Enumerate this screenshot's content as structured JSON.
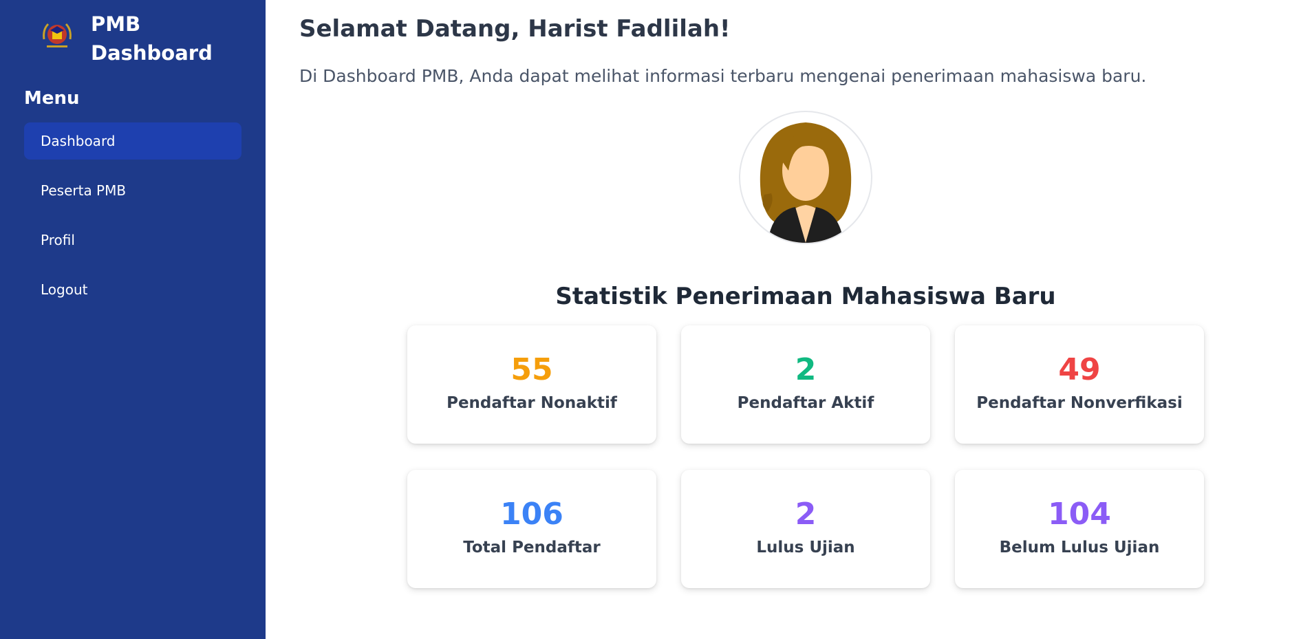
{
  "sidebar": {
    "brand_title_line1": "PMB",
    "brand_title_line2": "Dashboard",
    "brand_logo_icon": "graduation-emblem-icon",
    "menu_heading": "Menu",
    "items": [
      {
        "label": "Dashboard",
        "active": true
      },
      {
        "label": "Peserta PMB",
        "active": false
      },
      {
        "label": "Profil",
        "active": false
      },
      {
        "label": "Logout",
        "active": false
      }
    ]
  },
  "main": {
    "welcome": "Selamat Datang, Harist Fadlilah!",
    "intro": "Di Dashboard PMB, Anda dapat melihat informasi terbaru mengenai penerimaan mahasiswa baru.",
    "avatar_icon": "user-avatar-icon",
    "stats_title": "Statistik Penerimaan Mahasiswa Baru",
    "stats": [
      {
        "value": "55",
        "label": "Pendaftar Nonaktif",
        "color": "#f59e0b"
      },
      {
        "value": "2",
        "label": "Pendaftar Aktif",
        "color": "#10b981"
      },
      {
        "value": "49",
        "label": "Pendaftar Nonverfikasi",
        "color": "#ef4444"
      },
      {
        "value": "106",
        "label": "Total Pendaftar",
        "color": "#3b82f6"
      },
      {
        "value": "2",
        "label": "Lulus Ujian",
        "color": "#8b5cf6"
      },
      {
        "value": "104",
        "label": "Belum Lulus Ujian",
        "color": "#8b5cf6"
      }
    ]
  },
  "colors": {
    "sidebar_bg": "#1e3a8a",
    "active_item_bg": "#1e40af"
  }
}
